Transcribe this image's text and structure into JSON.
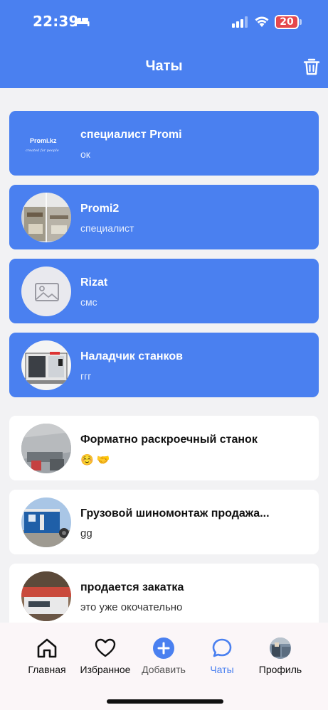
{
  "status_bar": {
    "time": "22:39",
    "battery": "20",
    "battery_level": 0.2,
    "battery_color": "#e5484d"
  },
  "header": {
    "title": "Чаты",
    "background": "#4a80f0"
  },
  "chats": [
    {
      "name": "специалист Promi",
      "message": "ок",
      "highlighted": true,
      "avatar": "promi-logo",
      "logo_text": "Promi.kz",
      "logo_tagline": "created for people"
    },
    {
      "name": "Promi2",
      "message": "специалист",
      "highlighted": true,
      "avatar": "workshop-photo"
    },
    {
      "name": "Rizat",
      "message": "смс",
      "highlighted": true,
      "avatar": "image-placeholder-icon"
    },
    {
      "name": "Наладчик станков",
      "message": "ггг",
      "highlighted": true,
      "avatar": "machine-photo"
    },
    {
      "name": "Форматно раскроечный станок",
      "message": "☺️ 🤝",
      "highlighted": false,
      "avatar": "saw-photo"
    },
    {
      "name": "Грузовой шиномонтаж продажа...",
      "message": "gg",
      "highlighted": false,
      "avatar": "container-photo"
    },
    {
      "name": "продается закатка",
      "message": "это уже окочательно",
      "highlighted": false,
      "avatar": "edgebander-photo"
    }
  ],
  "nav": {
    "home": "Главная",
    "favorites": "Избранное",
    "add": "Добавить",
    "chats": "Чаты",
    "profile": "Профиль",
    "active": "chats"
  }
}
